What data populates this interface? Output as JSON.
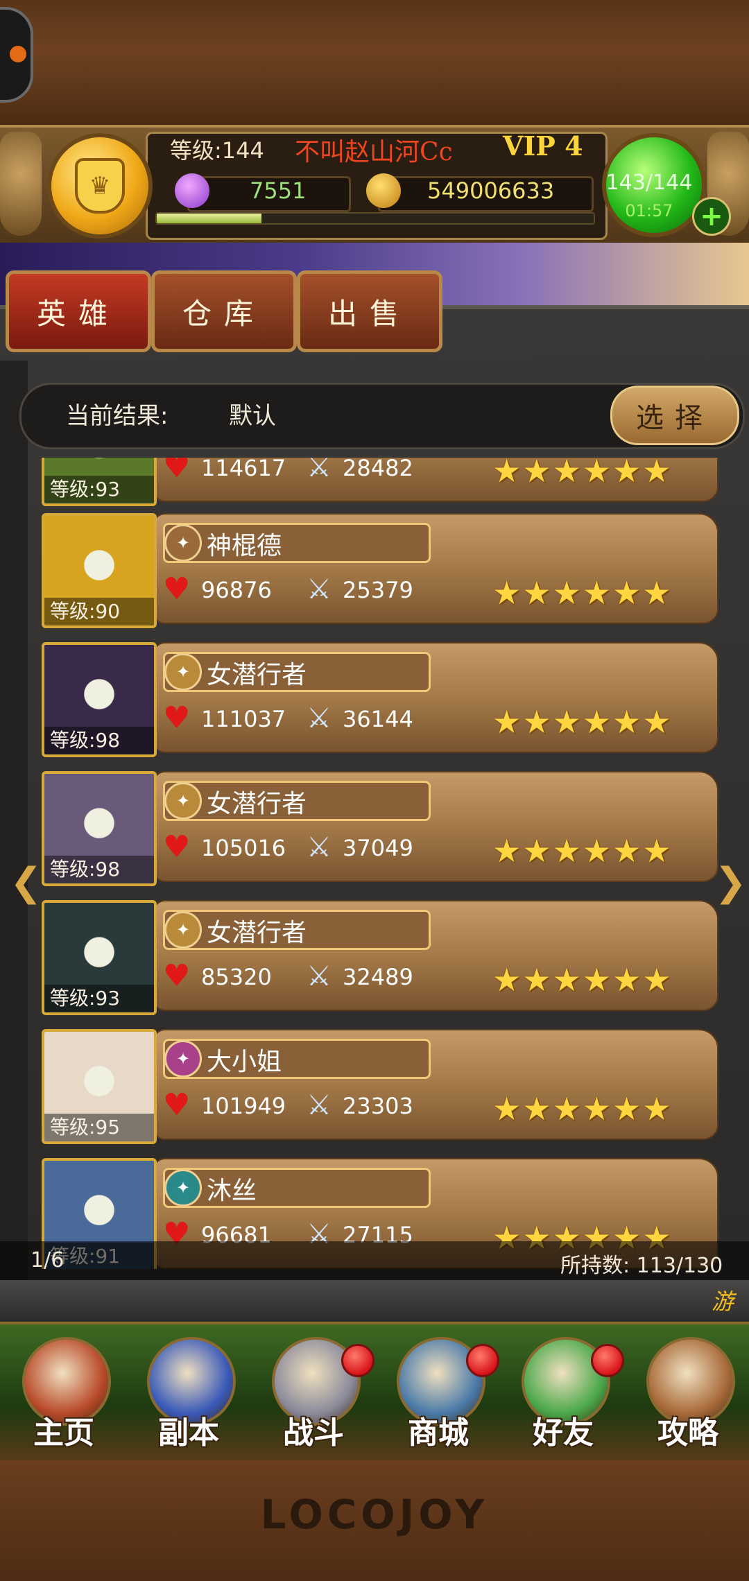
{
  "header": {
    "level_text": "等级:144",
    "player_name": "不叫赵山河Cc",
    "vip": "VIP 4",
    "currency_gem": "7551",
    "currency_gold": "549006633",
    "stamina": "143/144",
    "stamina_timer": "01:57",
    "xp_progress": 0.24,
    "plus_label": "+"
  },
  "tabs": [
    {
      "label": "英雄",
      "active": true
    },
    {
      "label": "仓库",
      "active": false
    },
    {
      "label": "出售",
      "active": false
    }
  ],
  "filter": {
    "label": "当前结果:",
    "value": "默认",
    "button": "选择"
  },
  "heroes": [
    {
      "name": "",
      "level": "等级:93",
      "hp": "114617",
      "atk": "28482",
      "stars": 6,
      "class_color": "#a06a28",
      "portrait_color": "#5a7a2a"
    },
    {
      "name": "神棍德",
      "level": "等级:90",
      "hp": "96876",
      "atk": "25379",
      "stars": 6,
      "class_color": "#9a6a3a",
      "portrait_color": "#d8a420"
    },
    {
      "name": "女潜行者",
      "level": "等级:98",
      "hp": "111037",
      "atk": "36144",
      "stars": 6,
      "class_color": "#b88a3a",
      "portrait_color": "#3a2a4a"
    },
    {
      "name": "女潜行者",
      "level": "等级:98",
      "hp": "105016",
      "atk": "37049",
      "stars": 6,
      "class_color": "#b88a3a",
      "portrait_color": "#6a5a7a"
    },
    {
      "name": "女潜行者",
      "level": "等级:93",
      "hp": "85320",
      "atk": "32489",
      "stars": 6,
      "class_color": "#b88a3a",
      "portrait_color": "#2a3a3a"
    },
    {
      "name": "大小姐",
      "level": "等级:95",
      "hp": "101949",
      "atk": "23303",
      "stars": 6,
      "class_color": "#a8408a",
      "portrait_color": "#e8d8c8"
    },
    {
      "name": "沐丝",
      "level": "等级:91",
      "hp": "96681",
      "atk": "27115",
      "stars": 6,
      "class_color": "#2a8a8a",
      "portrait_color": "#4a6a9a"
    }
  ],
  "pagination": {
    "page": "1/6",
    "owned": "所持数: 113/130"
  },
  "ticker": "游",
  "nav": [
    {
      "label": "主页",
      "badge": false,
      "color": "#b84a2a"
    },
    {
      "label": "副本",
      "badge": false,
      "color": "#3a5ab8"
    },
    {
      "label": "战斗",
      "badge": true,
      "color": "#8a8a9a"
    },
    {
      "label": "商城",
      "badge": true,
      "color": "#4a7aa8"
    },
    {
      "label": "好友",
      "badge": true,
      "color": "#4aa84a"
    },
    {
      "label": "攻略",
      "badge": false,
      "color": "#a86a3a"
    }
  ],
  "brand": "LOCOJOY"
}
